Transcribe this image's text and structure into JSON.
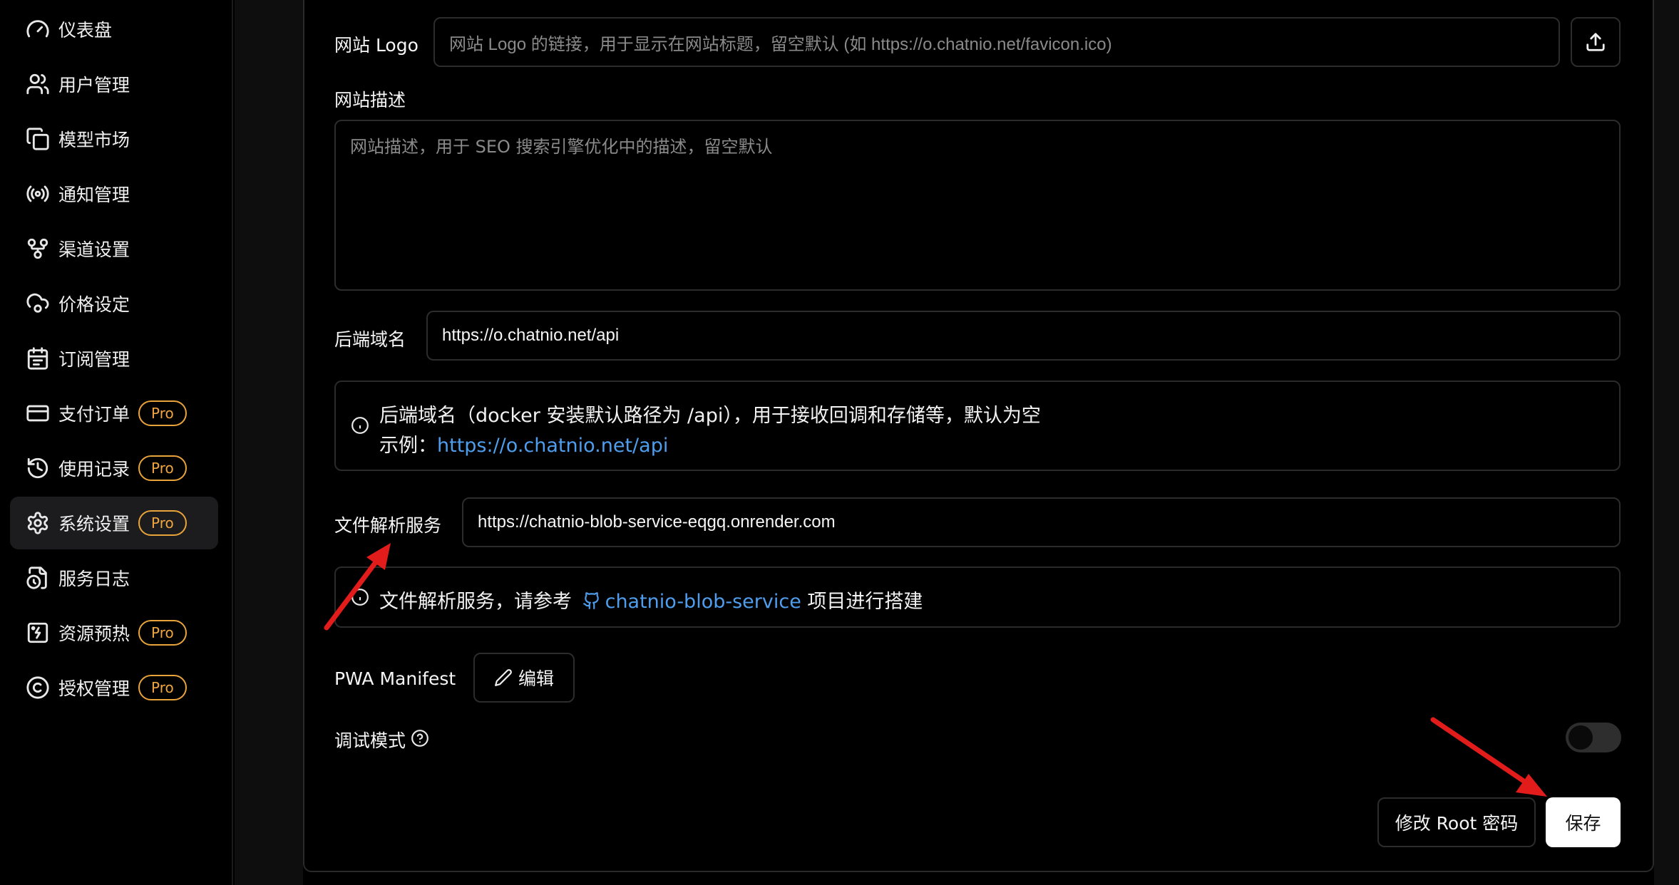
{
  "sidebar": {
    "items": [
      {
        "label": "仪表盘",
        "icon": "gauge-icon",
        "pro": false,
        "active": false
      },
      {
        "label": "用户管理",
        "icon": "users-icon",
        "pro": false,
        "active": false
      },
      {
        "label": "模型市场",
        "icon": "copy-icon",
        "pro": false,
        "active": false
      },
      {
        "label": "通知管理",
        "icon": "radio-icon",
        "pro": false,
        "active": false
      },
      {
        "label": "渠道设置",
        "icon": "git-fork-icon",
        "pro": false,
        "active": false
      },
      {
        "label": "价格设定",
        "icon": "cloud-cog-icon",
        "pro": false,
        "active": false
      },
      {
        "label": "订阅管理",
        "icon": "calendar-icon",
        "pro": false,
        "active": false
      },
      {
        "label": "支付订单",
        "icon": "credit-card-icon",
        "pro": true,
        "active": false
      },
      {
        "label": "使用记录",
        "icon": "history-icon",
        "pro": true,
        "active": false
      },
      {
        "label": "系统设置",
        "icon": "settings-icon",
        "pro": true,
        "active": true
      },
      {
        "label": "服务日志",
        "icon": "file-clock-icon",
        "pro": false,
        "active": false
      },
      {
        "label": "资源预热",
        "icon": "image-zap-icon",
        "pro": true,
        "active": false
      },
      {
        "label": "授权管理",
        "icon": "copyright-icon",
        "pro": true,
        "active": false
      }
    ],
    "pro_label": "Pro"
  },
  "form": {
    "logo_label": "网站 Logo",
    "logo_placeholder": "网站 Logo 的链接，用于显示在网站标题，留空默认 (如 https://o.chatnio.net/favicon.ico)",
    "desc_label": "网站描述",
    "desc_placeholder": "网站描述，用于 SEO 搜索引擎优化中的描述，留空默认",
    "backend_label": "后端域名",
    "backend_value": "https://o.chatnio.net/api",
    "backend_info_line1": "后端域名（docker 安装默认路径为 /api），用于接收回调和存储等，默认为空",
    "backend_info_prefix": "示例：",
    "backend_info_link": "https://o.chatnio.net/api",
    "file_label": "文件解析服务",
    "file_value": "https://chatnio-blob-service-eqgq.onrender.com",
    "file_info_prefix": "文件解析服务，请参考",
    "file_info_link": "chatnio-blob-service",
    "file_info_suffix": "项目进行搭建",
    "pwa_label": "PWA Manifest",
    "pwa_edit": "编辑",
    "debug_label": "调试模式",
    "debug_enabled": false
  },
  "actions": {
    "change_root": "修改 Root 密码",
    "save": "保存"
  },
  "colors": {
    "accent_link": "#4f9eee",
    "pro_badge": "#e8a33a",
    "annotation_arrow": "#e21b1b"
  }
}
